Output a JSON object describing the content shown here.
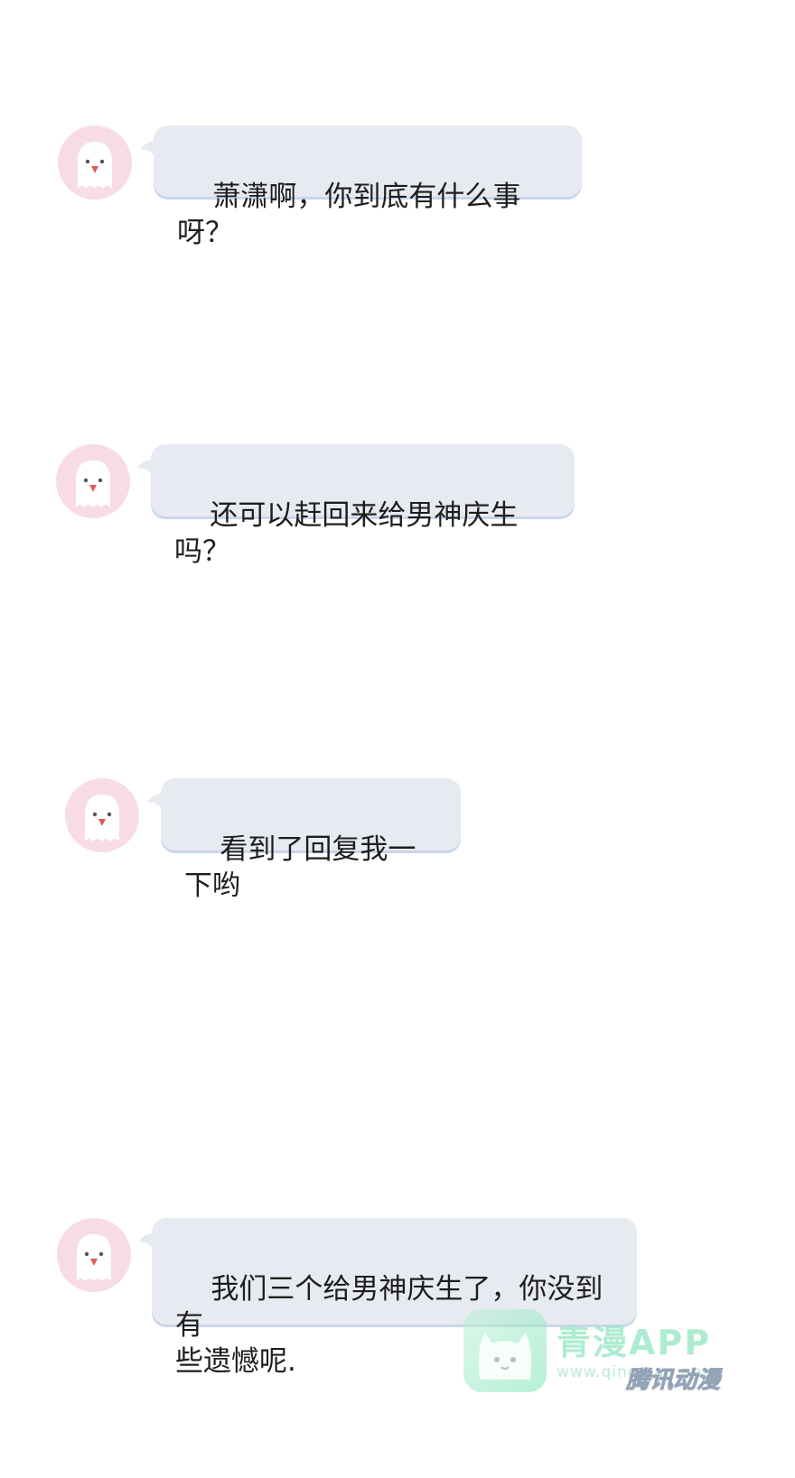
{
  "messages": [
    {
      "text": "萧潇啊，你到底有什么事呀？"
    },
    {
      "text": "还可以赶回来给男神庆生吗？"
    },
    {
      "text": "看到了回复我一下哟"
    },
    {
      "text": "我们三个给男神庆生了，你没到有\n些遗憾呢."
    }
  ],
  "watermark": {
    "title": "青漫APP",
    "url": "www.qingman.app",
    "sub": "腾讯动漫"
  },
  "colors": {
    "bubble": "#e7eaf0",
    "bubble_shadow": "#c9d6ec",
    "avatar_bg": "#f7dde3"
  }
}
